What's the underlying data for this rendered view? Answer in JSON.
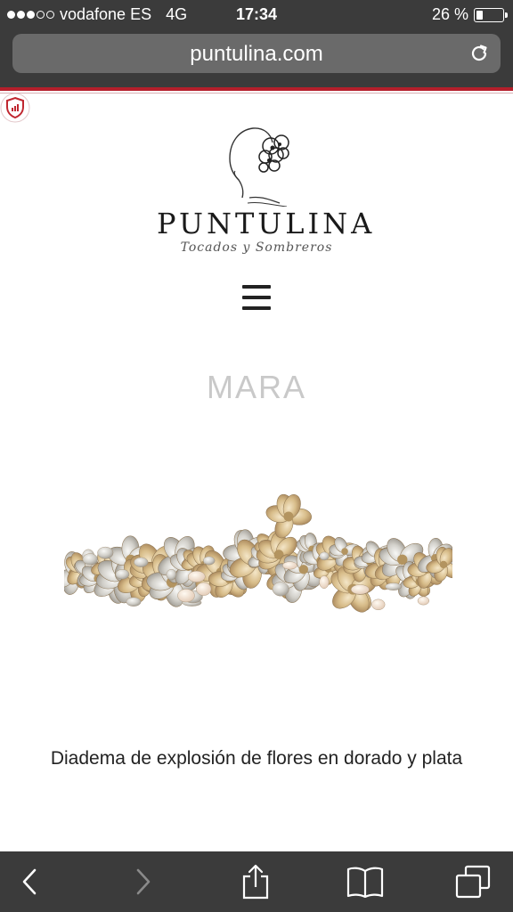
{
  "status_bar": {
    "carrier": "vodafone ES",
    "network": "4G",
    "time": "17:34",
    "battery": "26 %",
    "battery_level": 0.26,
    "signal_bars_on": 3,
    "signal_bars_total": 5
  },
  "browser": {
    "url": "puntulina.com",
    "reload_icon": "reload-icon"
  },
  "site": {
    "brand": "PUNTULINA",
    "tagline": "Tocados y Sombreros",
    "menu_icon": "hamburger-menu-icon"
  },
  "product": {
    "title": "MARA",
    "description": "Diadema de explosión de flores en dorado y plata"
  },
  "toolbar": {
    "back_icon": "back-chevron-icon",
    "forward_icon": "forward-chevron-icon",
    "share_icon": "share-icon",
    "bookmarks_icon": "bookmarks-book-icon",
    "tabs_icon": "tabs-icon"
  },
  "colors": {
    "chrome_bg": "#3b3b3b",
    "url_field": "#6a6a6a",
    "accent_red": "#b51f2b",
    "title_gray": "#c9c9c9"
  }
}
